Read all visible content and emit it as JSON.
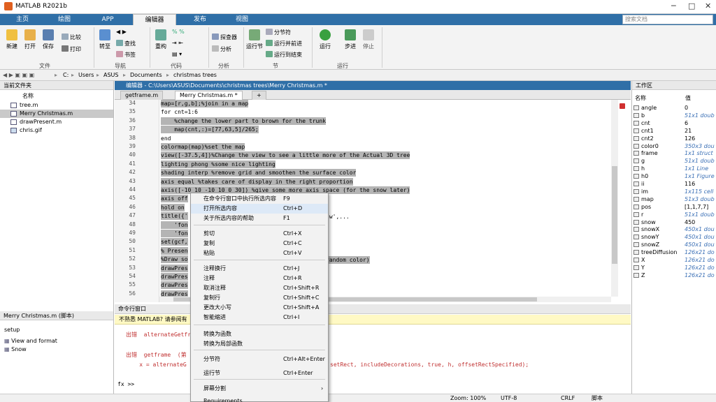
{
  "window": {
    "title": "MATLAB R2021b"
  },
  "ribbon_tabs": [
    {
      "label": "主页"
    },
    {
      "label": "绘图"
    },
    {
      "label": "APP"
    },
    {
      "label": "编辑器"
    },
    {
      "label": "发布"
    },
    {
      "label": "视图"
    }
  ],
  "search": {
    "placeholder": "搜索文档"
  },
  "ribbon": {
    "buttons": [
      "新建",
      "打开",
      "保存",
      "转至",
      "重构",
      "运行节",
      "运行",
      "步进",
      "停止"
    ],
    "small": [
      "比较",
      "打印",
      "查找",
      "书签",
      "探查器",
      "分析",
      "分节符",
      "运行并前进",
      "运行到结束"
    ],
    "groups": [
      "文件",
      "导航",
      "代码",
      "分析",
      "节",
      "运行"
    ]
  },
  "path": {
    "crumbs": [
      "C:",
      "Users",
      "ASUS",
      "Documents",
      "christmas trees"
    ]
  },
  "current_folder": {
    "title": "当前文件夹",
    "column": "名称",
    "files": [
      "tree.m",
      "Merry Christmas.m",
      "drawPresent.m",
      "chris.gif"
    ]
  },
  "details": {
    "title": "Merry Christmas.m  (脚本)",
    "section": "setup",
    "items": [
      "View and format",
      "Snow"
    ]
  },
  "editor": {
    "title": "编辑器 - C:\\Users\\ASUS\\Documents\\christmas trees\\Merry Christmas.m *",
    "tabs": [
      "getframe.m",
      "Merry Christmas.m *",
      "+"
    ],
    "lines": [
      {
        "n": "34",
        "t": "map=[r,g,b];%join in a map"
      },
      {
        "n": "35",
        "t": "for cnt=1:6"
      },
      {
        "n": "36",
        "t": "    %change the lower part to brown for the trunk"
      },
      {
        "n": "37",
        "t": "    map(cnt,:)=[77,63,5]/265;"
      },
      {
        "n": "38",
        "t": "end"
      },
      {
        "n": "39",
        "t": "colormap(map)%set the map"
      },
      {
        "n": "40",
        "t": "view([-37.5,4])%Change the view to see a little more of the Actual 3D tree"
      },
      {
        "n": "41",
        "t": "lighting phong %some nice lighting"
      },
      {
        "n": "42",
        "t": "shading interp %remove grid and smoothen the surface color"
      },
      {
        "n": "43",
        "t": "axis equal %takes care of display in the right proportion"
      },
      {
        "n": "44",
        "t": "axis([-10 10 -10 10 0 30]) %give some more axis space (for the snow later)"
      },
      {
        "n": "45",
        "t": "axis off"
      },
      {
        "n": "46",
        "t": "hold on"
      },
      {
        "n": "47",
        "t": "title({'"
      },
      {
        "n": "48",
        "t": "    'fon"
      },
      {
        "n": "49",
        "t": "    'fon"
      },
      {
        "n": "50",
        "t": "set(gcf,"
      },
      {
        "n": "51",
        "t": "% Presen"
      },
      {
        "n": "52",
        "t": "%Draw so"
      },
      {
        "n": "53",
        "t": "drawPres"
      },
      {
        "n": "54",
        "t": "drawPres"
      },
      {
        "n": "55",
        "t": "drawPres"
      },
      {
        "n": "56",
        "t": "drawPres"
      }
    ],
    "fragments": [
      "'w',...",
      "random color)"
    ]
  },
  "command_window": {
    "title": "命令行窗口",
    "notice": "不熟悉 MATLAB? 请参阅有",
    "lines": [
      "出错  alternateGetfr",
      "出错  getframe  (第",
      "    x = alternateG"
    ],
    "tail": "setRect, includeDecorations, true, h, offsetRectSpecified);",
    "prompt": "fx >>"
  },
  "workspace": {
    "title": "工作区",
    "col_name": "名称",
    "col_value": "值",
    "vars": [
      {
        "name": "angle",
        "value": "0",
        "italic": false
      },
      {
        "name": "b",
        "value": "51x1 doub",
        "italic": true
      },
      {
        "name": "cnt",
        "value": "6",
        "italic": false
      },
      {
        "name": "cnt1",
        "value": "21",
        "italic": false
      },
      {
        "name": "cnt2",
        "value": "126",
        "italic": false
      },
      {
        "name": "color0",
        "value": "350x3 dou",
        "italic": true
      },
      {
        "name": "frame",
        "value": "1x1 struct",
        "italic": true
      },
      {
        "name": "g",
        "value": "51x1 doub",
        "italic": true
      },
      {
        "name": "h",
        "value": "1x1 Line",
        "italic": true
      },
      {
        "name": "h0",
        "value": "1x1 Figure",
        "italic": true
      },
      {
        "name": "ii",
        "value": "116",
        "italic": false
      },
      {
        "name": "im",
        "value": "1x115 cell",
        "italic": true
      },
      {
        "name": "map",
        "value": "51x3 doub",
        "italic": true
      },
      {
        "name": "pos",
        "value": "[1,1,7,7]",
        "italic": false
      },
      {
        "name": "r",
        "value": "51x1 doub",
        "italic": true
      },
      {
        "name": "snow",
        "value": "450",
        "italic": false
      },
      {
        "name": "snowX",
        "value": "450x1 dou",
        "italic": true
      },
      {
        "name": "snowY",
        "value": "450x1 dou",
        "italic": true
      },
      {
        "name": "snowZ",
        "value": "450x1 dou",
        "italic": true
      },
      {
        "name": "treeDiffusion",
        "value": "126x21 do",
        "italic": true
      },
      {
        "name": "X",
        "value": "126x21 do",
        "italic": true
      },
      {
        "name": "Y",
        "value": "126x21 do",
        "italic": true
      },
      {
        "name": "Z",
        "value": "126x21 do",
        "italic": true
      }
    ]
  },
  "context_menu": {
    "items": [
      {
        "label": "在命令行窗口中执行所选内容",
        "shortcut": "F9"
      },
      {
        "label": "打开所选内容",
        "shortcut": "Ctrl+D"
      },
      {
        "label": "关于所选内容的帮助",
        "shortcut": "F1"
      },
      {
        "label": "剪切",
        "shortcut": "Ctrl+X"
      },
      {
        "label": "复制",
        "shortcut": "Ctrl+C"
      },
      {
        "label": "粘贴",
        "shortcut": "Ctrl+V"
      },
      {
        "label": "注释换行",
        "shortcut": "Ctrl+J"
      },
      {
        "label": "注释",
        "shortcut": "Ctrl+R"
      },
      {
        "label": "取消注释",
        "shortcut": "Ctrl+Shift+R"
      },
      {
        "label": "复制行",
        "shortcut": "Ctrl+Shift+C"
      },
      {
        "label": "更改大小写",
        "shortcut": "Ctrl+Shift+A"
      },
      {
        "label": "智能缩进",
        "shortcut": "Ctrl+I"
      },
      {
        "label": "转换为函数",
        "shortcut": ""
      },
      {
        "label": "转换为局部函数",
        "shortcut": ""
      },
      {
        "label": "分节符",
        "shortcut": "Ctrl+Alt+Enter"
      },
      {
        "label": "运行节",
        "shortcut": "Ctrl+Enter"
      },
      {
        "label": "屏幕分割",
        "shortcut": ""
      },
      {
        "label": "Requirements",
        "shortcut": ""
      }
    ]
  },
  "status": {
    "zoom": "Zoom: 100%",
    "encoding": "UTF-8",
    "eol": "CRLF",
    "type": "脚本"
  },
  "colors": {
    "accent": "#2f6fa7",
    "selection": "#b4b4b4"
  }
}
